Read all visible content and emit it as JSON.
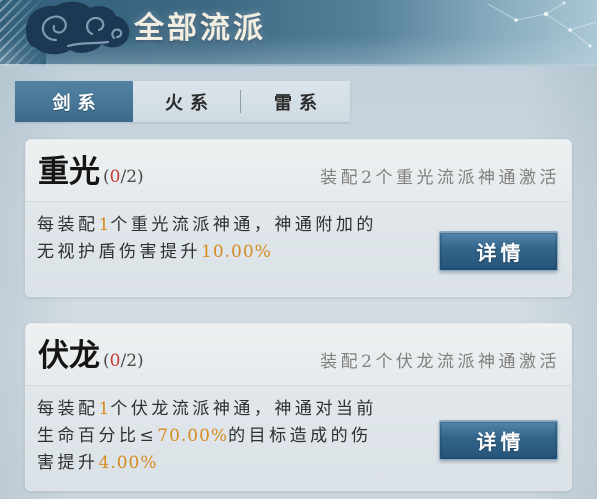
{
  "header": {
    "title": "全部流派",
    "ornament_icon": "cloud-swirl-icon",
    "sky_icon": "constellation-icon"
  },
  "tabs": [
    {
      "label": "剑系",
      "active": true
    },
    {
      "label": "火系",
      "active": false
    },
    {
      "label": "雷系",
      "active": false
    }
  ],
  "schools": [
    {
      "name": "重光",
      "progress": {
        "prefix": "(",
        "current": "0",
        "suffix": "/2)"
      },
      "activation_hint": "装配2个重光流派神通激活",
      "description": [
        [
          {
            "text": "每装配"
          },
          {
            "text": "1",
            "highlight": true
          },
          {
            "text": "个重光流派神通，神通附加的"
          }
        ],
        [
          {
            "text": "无视护盾伤害提升"
          },
          {
            "text": "10.00%",
            "highlight": true
          }
        ]
      ],
      "details_button": "详情"
    },
    {
      "name": "伏龙",
      "progress": {
        "prefix": "(",
        "current": "0",
        "suffix": "/2)"
      },
      "activation_hint": "装配2个伏龙流派神通激活",
      "description": [
        [
          {
            "text": "每装配"
          },
          {
            "text": "1",
            "highlight": true
          },
          {
            "text": "个伏龙流派神通，神通对当前"
          }
        ],
        [
          {
            "text": "生命百分比≤"
          },
          {
            "text": "70.00%",
            "highlight": true
          },
          {
            "text": "的目标造成的伤"
          }
        ],
        [
          {
            "text": "害提升"
          },
          {
            "text": "4.00%",
            "highlight": true
          }
        ]
      ],
      "details_button": "详情"
    }
  ],
  "colors": {
    "active_tab": "#3c6a8a",
    "highlight": "#d68a1f",
    "progress_current": "#c03a3a",
    "button": "#326489"
  }
}
